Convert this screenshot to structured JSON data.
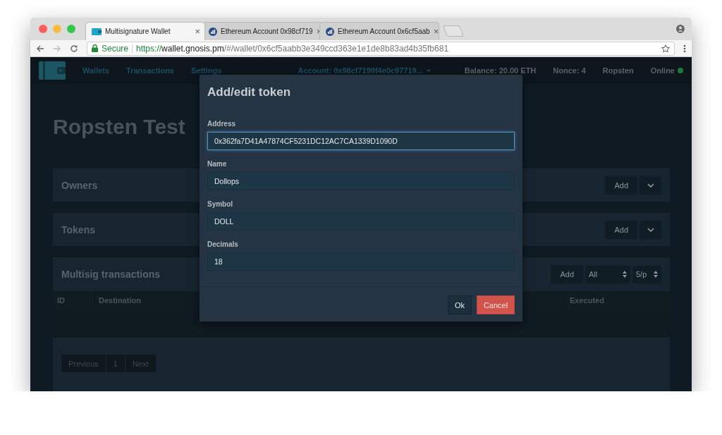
{
  "browser": {
    "tabs": [
      {
        "title": "Multisignature Wallet",
        "close": "×",
        "selected": true
      },
      {
        "title": "Ethereum Account 0x98cf719",
        "close": "×",
        "selected": false
      },
      {
        "title": "Ethereum Account 0x6cf5aab",
        "close": "×",
        "selected": false
      }
    ],
    "secure_label": "Secure",
    "url_scheme": "https://",
    "url_host": "wallet.gnosis.pm",
    "url_path": "/#/wallet/0x6cf5aabb3e349ccd363e1e1de8b83ad4b35fb681"
  },
  "navbar": {
    "links": [
      "Wallets",
      "Transactions",
      "Settings"
    ],
    "account": "Account: 0x98cf7199f4e0c97719...",
    "balance": "Balance: 20.00 ETH",
    "nonce": "Nonce: 4",
    "network": "Ropsten",
    "status": "Online",
    "online": true
  },
  "page": {
    "title": "Ropsten Test",
    "panels": [
      {
        "title": "Owners",
        "button": "Add"
      },
      {
        "title": "Tokens",
        "button": "Add"
      }
    ],
    "transactions": {
      "title": "Multisig transactions",
      "button": "Add",
      "filter": "All",
      "page_size": "5/p",
      "columns": [
        "ID",
        "Destination",
        "Executed"
      ],
      "pagination": [
        "Previous",
        "1",
        "Next"
      ]
    }
  },
  "modal": {
    "title": "Add/edit token",
    "fields": [
      {
        "label": "Address",
        "value": "0x362fa7D41A47874CF5231DC12AC7CA1339D1090D",
        "focused": true
      },
      {
        "label": "Name",
        "value": "Dollops",
        "focused": false
      },
      {
        "label": "Symbol",
        "value": "DOLL",
        "focused": false
      },
      {
        "label": "Decimals",
        "value": "18",
        "focused": false
      }
    ],
    "ok": "Ok",
    "cancel": "Cancel"
  }
}
